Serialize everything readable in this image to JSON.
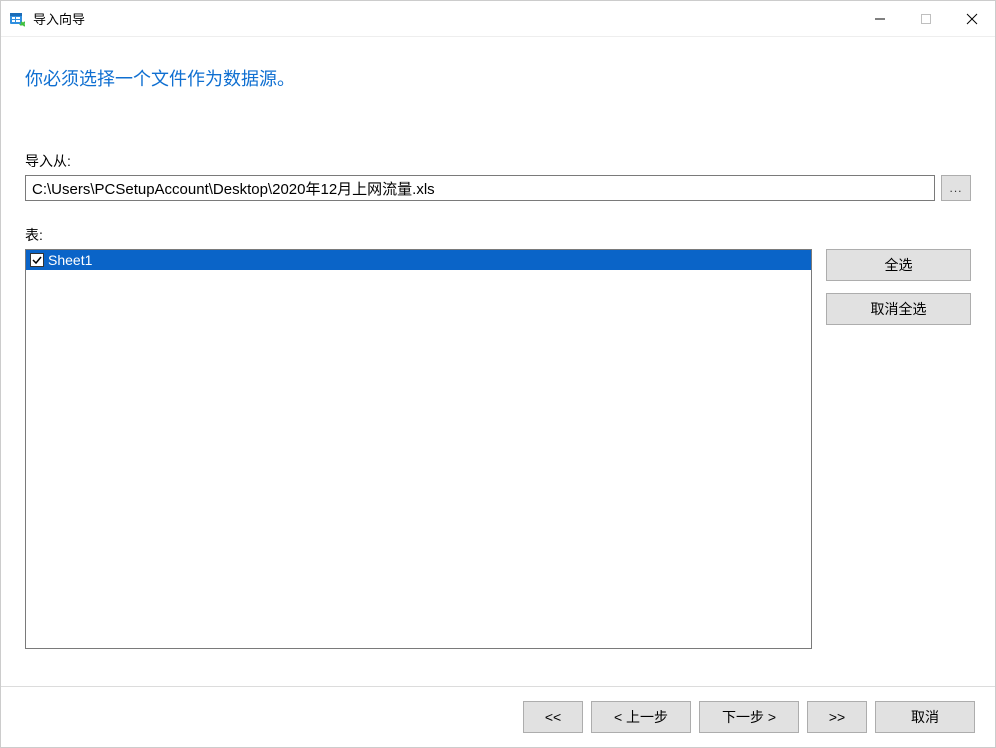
{
  "window": {
    "title": "导入向导"
  },
  "heading": "你必须选择一个文件作为数据源。",
  "import_from": {
    "label": "导入从:",
    "value": "C:\\Users\\PCSetupAccount\\Desktop\\2020年12月上网流量.xls",
    "browse_label": "..."
  },
  "tables": {
    "label": "表:",
    "items": [
      {
        "name": "Sheet1",
        "checked": true,
        "selected": true
      }
    ],
    "select_all_label": "全选",
    "deselect_all_label": "取消全选"
  },
  "footer": {
    "first_label": "<<",
    "prev_label": "< 上一步",
    "next_label": "下一步 >",
    "last_label": ">>",
    "cancel_label": "取消"
  }
}
